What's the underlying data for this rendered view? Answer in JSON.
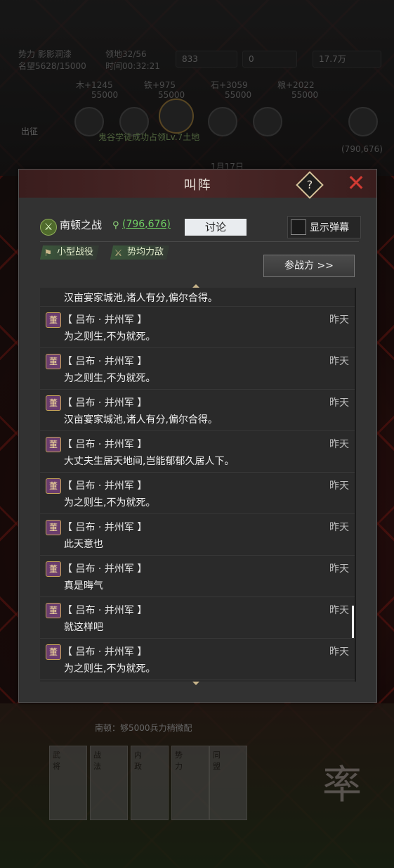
{
  "hud": {
    "influence_label": "势力 影影洞漆",
    "reputation": "名望5628/15000",
    "territory": "领地32/56",
    "timer": "时间00:32:21",
    "gold": "833",
    "jade": "0",
    "copper": "17.7万",
    "wood": "木+1245",
    "iron": "铁+975",
    "stone": "石+3059",
    "grain": "粮+2022",
    "cap": "55000",
    "notice": "鬼谷学徒成功占领Lv.7土地",
    "date": "1月17日",
    "coord": "(790,676)",
    "deploy": "出征",
    "bottom_info": "南顿：够5000兵力稍微配",
    "card_labels": [
      "武将",
      "战法",
      "内政",
      "势力",
      "同盟"
    ],
    "seal": "率"
  },
  "dialog": {
    "title": "叫阵",
    "help_symbol": "?",
    "close_symbol": "✕",
    "battle_name": "南顿之战",
    "coords": "(796,676)",
    "discuss_label": "讨论",
    "barrage_label": "显示弹幕",
    "tags": [
      "小型战役",
      "势均力敌"
    ],
    "participants_label": "参战方 >>"
  },
  "chat": {
    "first_text": "汉亩宴家城池,诸人有分,偏尔合得。",
    "messages": [
      {
        "avatar": "董",
        "sender": "【 吕布 · 并州军 】",
        "time": "昨天",
        "text": "为之则生,不为就死。"
      },
      {
        "avatar": "董",
        "sender": "【 吕布 · 并州军 】",
        "time": "昨天",
        "text": "为之则生,不为就死。"
      },
      {
        "avatar": "董",
        "sender": "【 吕布 · 并州军 】",
        "time": "昨天",
        "text": "汉亩宴家城池,诸人有分,偏尔合得。"
      },
      {
        "avatar": "董",
        "sender": "【 吕布 · 并州军 】",
        "time": "昨天",
        "text": "大丈夫生居天地间,岂能郁郁久居人下。"
      },
      {
        "avatar": "董",
        "sender": "【 吕布 · 并州军 】",
        "time": "昨天",
        "text": "为之则生,不为就死。"
      },
      {
        "avatar": "董",
        "sender": "【 吕布 · 并州军 】",
        "time": "昨天",
        "text": "此天意也"
      },
      {
        "avatar": "董",
        "sender": "【 吕布 · 并州军 】",
        "time": "昨天",
        "text": "真是晦气"
      },
      {
        "avatar": "董",
        "sender": "【 吕布 · 并州军 】",
        "time": "昨天",
        "text": "就这样吧"
      },
      {
        "avatar": "董",
        "sender": "【 吕布 · 并州军 】",
        "time": "昨天",
        "text": "为之则生,不为就死。"
      }
    ]
  }
}
